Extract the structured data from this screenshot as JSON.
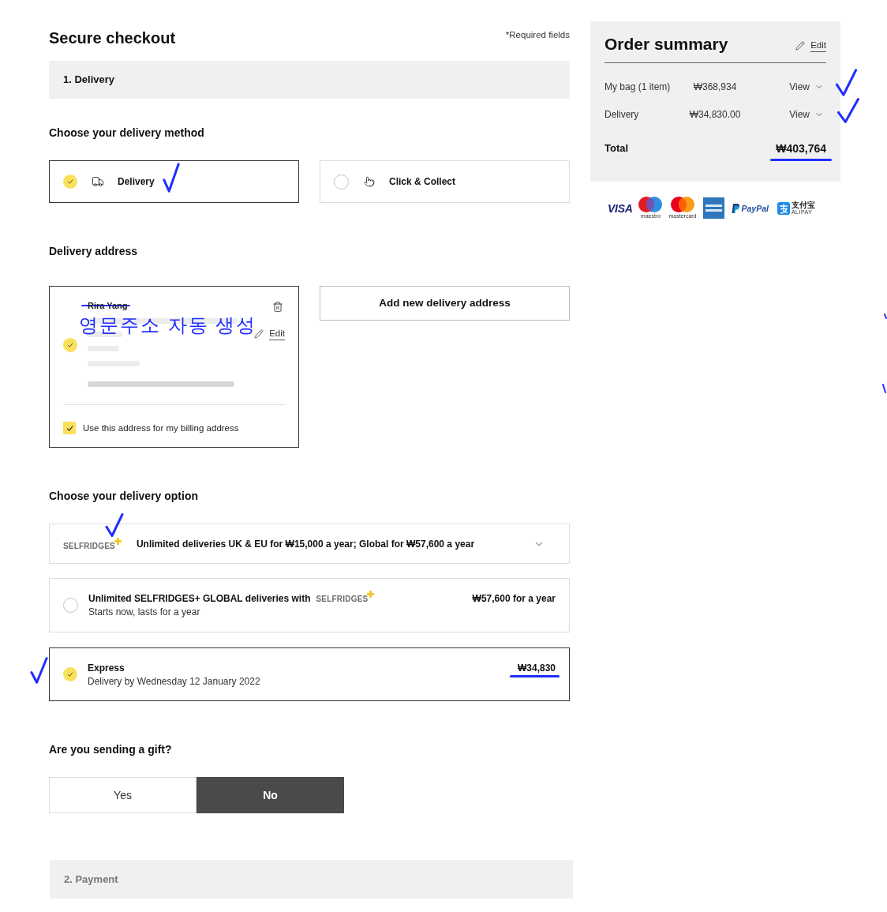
{
  "header": {
    "title": "Secure checkout",
    "required_note": "*Required fields"
  },
  "delivery_step": {
    "label": "1. Delivery",
    "active": true
  },
  "delivery_method": {
    "heading": "Choose your delivery method",
    "options": [
      {
        "kind": "delivery",
        "label": "Delivery",
        "selected": true,
        "annotated": true
      },
      {
        "kind": "collect",
        "label": "Click & Collect",
        "selected": false
      }
    ]
  },
  "delivery_address": {
    "heading": "Delivery address",
    "card": {
      "selected": true,
      "name": "Rira Yang",
      "struck": true,
      "note": "영문주소 자동 생성",
      "edit_label": "Edit",
      "billing": {
        "label": "Use this address for my billing address",
        "checked": true
      }
    },
    "add_button": "Add new delivery address"
  },
  "delivery_option": {
    "heading": "Choose your delivery option",
    "banner": {
      "logo": "SELFRIDGES",
      "text": "Unlimited deliveries UK & EU for ₩15,000 a year; Global for ₩57,600 a year",
      "annotated": true
    },
    "options": [
      {
        "title": "Unlimited SELFRIDGES+ GLOBAL deliveries with",
        "logo": "SELFRIDGES",
        "subtitle": "Starts now, lasts for a year",
        "price": "₩57,600 for a year",
        "selected": false
      },
      {
        "title": "Express",
        "subtitle": "Delivery by Wednesday 12 January 2022",
        "price": "₩34,830",
        "selected": true,
        "annotated": true,
        "underlined": true
      }
    ]
  },
  "gift": {
    "question": "Are you sending a gift?",
    "choices": [
      {
        "label": "Yes",
        "selected": false
      },
      {
        "label": "No",
        "selected": true
      }
    ]
  },
  "payment_step": {
    "label": "2. Payment",
    "active": false
  },
  "order_summary": {
    "title": "Order summary",
    "edit_label": "Edit",
    "rows": [
      {
        "label": "My bag (1 item)",
        "amount": "₩368,934",
        "action": "View",
        "annotated": true
      },
      {
        "label": "Delivery",
        "amount": "₩34,830.00",
        "action": "View",
        "annotated": true
      }
    ],
    "total": {
      "label": "Total",
      "amount": "₩403,764",
      "underlined": true
    }
  },
  "payment_methods": [
    {
      "kind": "visa",
      "label": "VISA"
    },
    {
      "kind": "maestro",
      "label": "maestro"
    },
    {
      "kind": "mastercard",
      "label": "mastercard"
    },
    {
      "kind": "amex"
    },
    {
      "kind": "paypal",
      "label": "PayPal"
    },
    {
      "kind": "alipay",
      "label": "支付宝",
      "sublabel": "ALIPAY"
    }
  ]
}
